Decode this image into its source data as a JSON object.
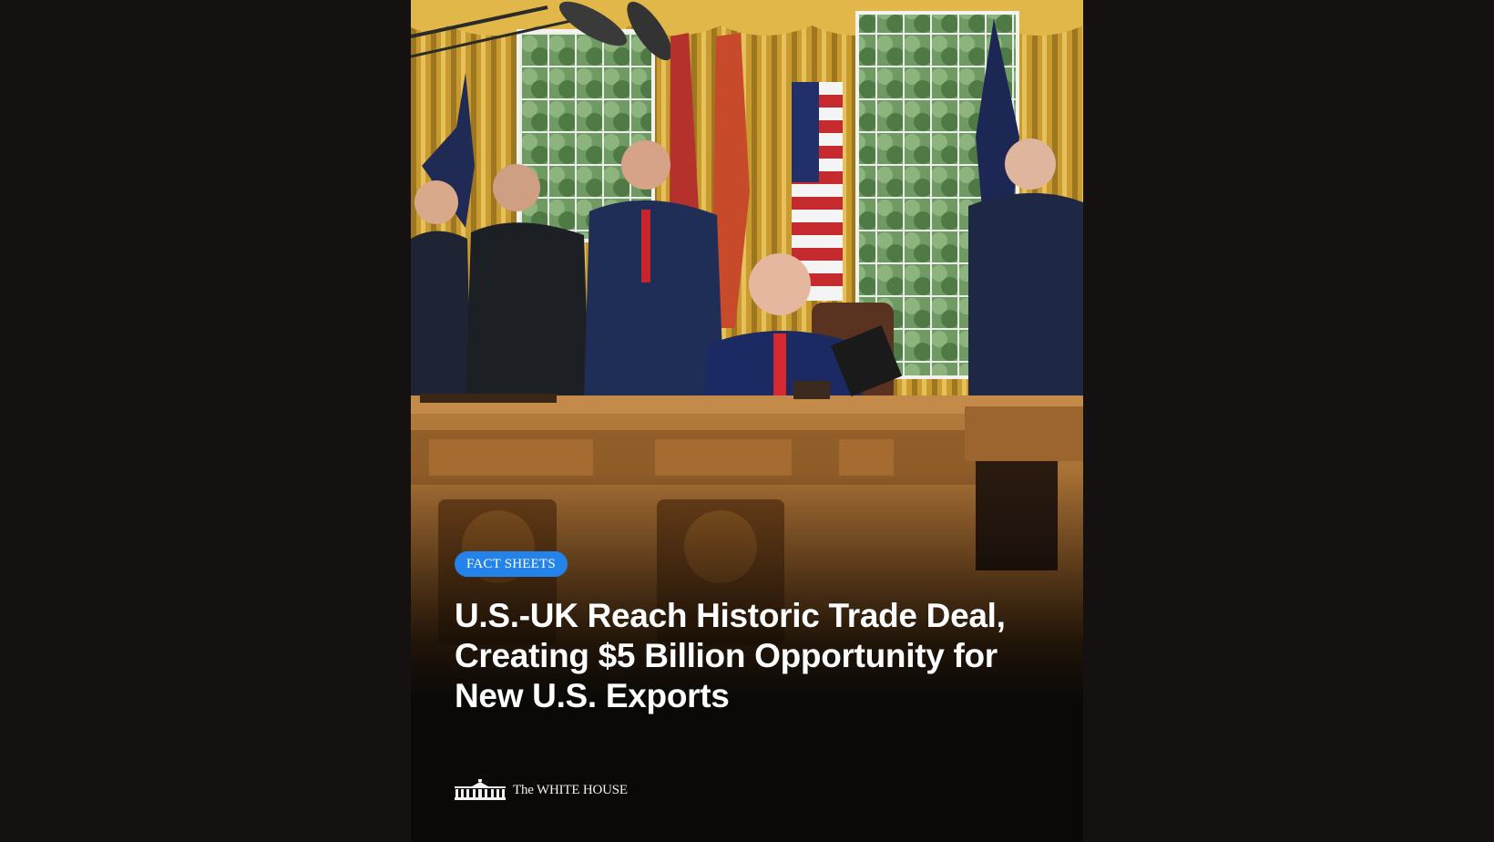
{
  "post": {
    "category_badge": "FACT SHEETS",
    "headline": "U.S.-UK Reach Historic Trade Deal, Creating $5 Billion Opportunity for New U.S. Exports",
    "brand": {
      "name": "The WHITE HOUSE",
      "logo_icon": "white-house-building-icon"
    },
    "photo_description_icon": "oval-office-photo"
  },
  "colors": {
    "page_background": "#141110",
    "badge_background": "#2483ea",
    "headline_text": "#ffffff",
    "card_footer": "#0a0908"
  }
}
